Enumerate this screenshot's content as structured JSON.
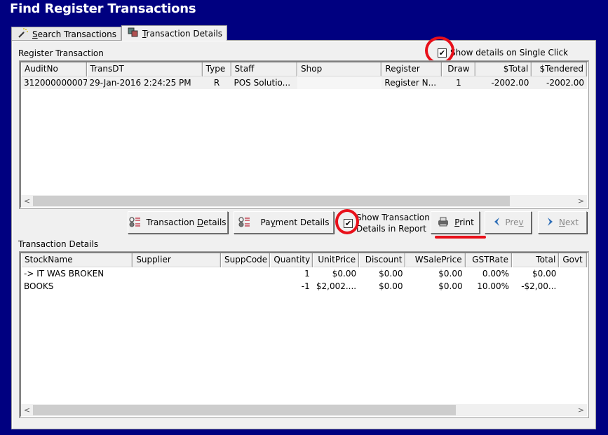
{
  "window": {
    "title": "Find Register Transactions"
  },
  "tabs": [
    {
      "label": "Search Transactions",
      "underline": "S",
      "rest": "earch Transactions",
      "icon": "magic-wand-icon",
      "active": false
    },
    {
      "label": "Transaction Details",
      "underline": "T",
      "rest": "ransaction Details",
      "icon": "stacked-windows-icon",
      "active": true
    }
  ],
  "register_transaction": {
    "group_label": "Register Transaction",
    "show_details_single_click": {
      "label": "Show details on Single Click",
      "checked": true
    },
    "columns": [
      "AuditNo",
      "TransDT",
      "Type",
      "Staff",
      "Shop",
      "Register",
      "Draw",
      "$Total",
      "$Tendered"
    ],
    "rows": [
      {
        "AuditNo": "312000000007",
        "TransDT": "29-Jan-2016 2:24:25 PM",
        "Type": "R",
        "Staff": "POS Solutio...",
        "Shop": "",
        "Register": "Register N...",
        "Draw": "1",
        "Total": "-2002.00",
        "Tendered": "-2002.00"
      }
    ],
    "scroll": {
      "left_arrow": "<",
      "right_arrow": ">",
      "thumb_fraction": 0.88
    }
  },
  "actions": {
    "transaction_details": {
      "label_pre": "Transaction ",
      "underline": "D",
      "label_post": "etails",
      "icon": "list-icon"
    },
    "payment_details": {
      "label_pre": "Pa",
      "underline": "y",
      "label_post": "ment Details",
      "icon": "list-icon"
    },
    "show_in_report": {
      "line1": "Show Transaction",
      "line2": "Details in Report",
      "checked": true
    },
    "print": {
      "underline": "P",
      "label_post": "rint",
      "icon": "printer-icon"
    },
    "prev": {
      "label_pre": "Pre",
      "underline": "v",
      "icon": "chevron-left-icon",
      "enabled": false
    },
    "next": {
      "underline": "N",
      "label_post": "ext",
      "icon": "chevron-right-icon",
      "enabled": false
    }
  },
  "transaction_details": {
    "group_label": "Transaction Details",
    "columns": [
      "StockName",
      "Supplier",
      "SuppCode",
      "Quantity",
      "UnitPrice",
      "Discount",
      "WSalePrice",
      "GSTRate",
      "Total",
      "Govt"
    ],
    "rows": [
      {
        "StockName": "-> IT WAS BROKEN",
        "Supplier": "",
        "SuppCode": "",
        "Quantity": "1",
        "UnitPrice": "$0.00",
        "Discount": "$0.00",
        "WSalePrice": "$0.00",
        "GSTRate": "0.00%",
        "Total": "$0.00",
        "Govt": ""
      },
      {
        "StockName": "BOOKS",
        "Supplier": "",
        "SuppCode": "",
        "Quantity": "-1",
        "UnitPrice": "$2,002....",
        "Discount": "$0.00",
        "WSalePrice": "$0.00",
        "GSTRate": "10.00%",
        "Total": "-$2,00...",
        "Govt": ""
      }
    ],
    "scroll": {
      "left_arrow": "<",
      "right_arrow": ">",
      "thumb_fraction": 0.78
    }
  },
  "colors": {
    "background": "#000080",
    "panel": "#f0f0f0",
    "annotation": "#e8101a"
  }
}
